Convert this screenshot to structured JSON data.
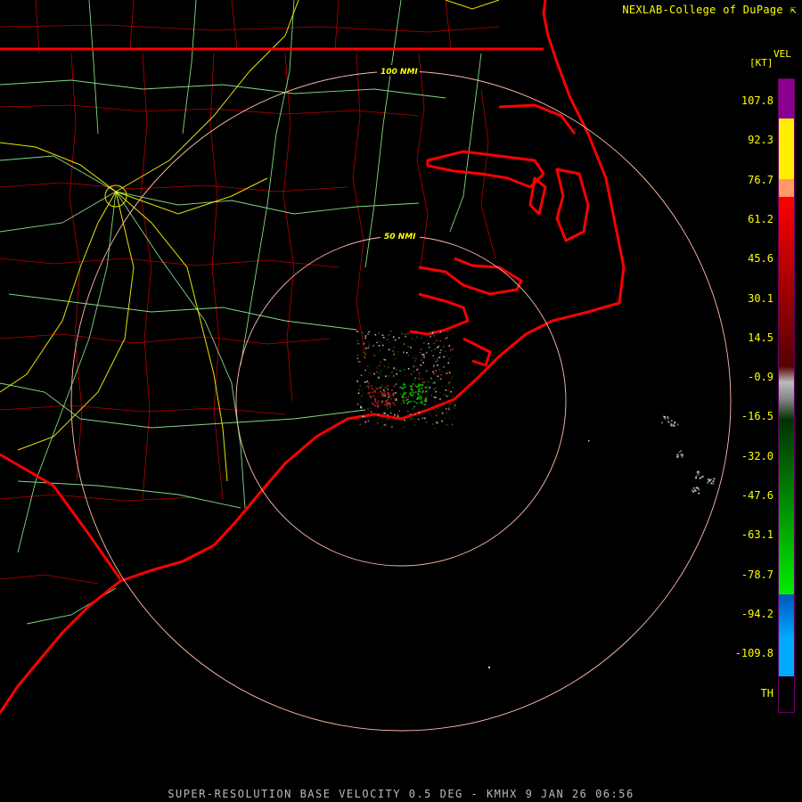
{
  "credit": "NEXLAB-College of DuPage",
  "caption": "SUPER-RESOLUTION BASE VELOCITY 0.5 DEG - KMHX 9 JAN 26 06:56",
  "legend": {
    "product": "VEL",
    "unit": "[KT]",
    "ticks": [
      "107.8",
      "92.3",
      "76.7",
      "61.2",
      "45.6",
      "30.1",
      "14.5",
      "-0.9",
      "-16.5",
      "-32.0",
      "-47.6",
      "-63.1",
      "-78.7",
      "-94.2",
      "-109.8",
      "TH"
    ],
    "colors": {
      "purple": "#8a0090",
      "yellow": "#ffff00",
      "orange": "#ffaa66",
      "red": "#ff0000",
      "darkred": "#660000",
      "gray": "#999999",
      "darkgreen": "#004400",
      "green": "#00ee00",
      "blue": "#0066cc",
      "cyan": "#0099ff"
    }
  },
  "range_rings": [
    {
      "label": "50 NMI"
    },
    {
      "label": "100 NMI"
    }
  ],
  "map_colors": {
    "state_lines": "#ff0000",
    "county_lines": "#cc0000",
    "highways": "#99ff99",
    "interstates": "#ffff00",
    "rings": "#ffbbaa"
  }
}
